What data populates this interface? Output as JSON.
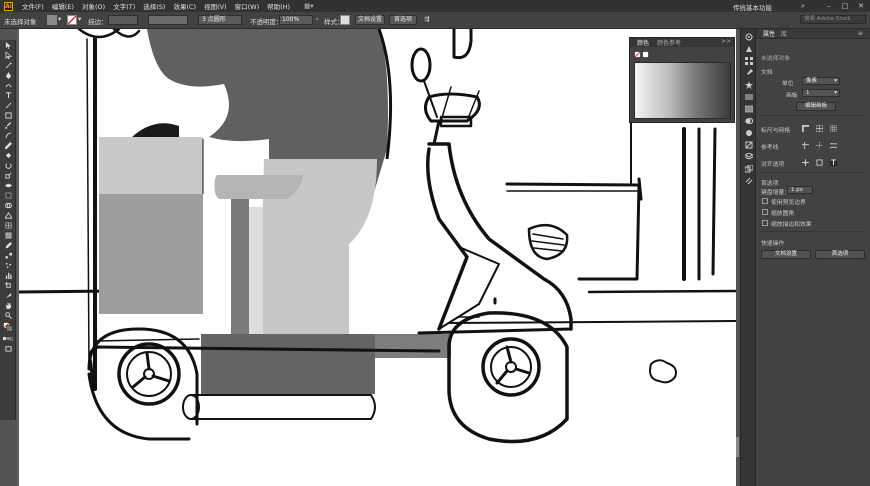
{
  "app": {
    "logo": "Ai",
    "accent": "#ff9a00"
  },
  "menu": {
    "items": [
      "文件(F)",
      "编辑(E)",
      "对象(O)",
      "文字(T)",
      "选择(S)",
      "效果(C)",
      "视图(V)",
      "窗口(W)",
      "帮助(H)"
    ],
    "layout_icon": "arrange-documents-icon",
    "workspace": "传统基本功能"
  },
  "control_bar": {
    "selection_label": "未选择对象",
    "stroke_label": "描边：",
    "brush_value": "3 点圆形",
    "opacity_label": "不透明度：",
    "opacity_value": "100%",
    "style_label": "样式：",
    "doc_setup": "文档设置",
    "preferences": "首选项",
    "search_placeholder": "搜索 Adobe Stock"
  },
  "tools": [
    "selection",
    "direct-selection",
    "magic-wand",
    "lasso",
    "pen",
    "curvature",
    "type",
    "line",
    "rectangle",
    "paintbrush",
    "shaper",
    "pencil",
    "eraser",
    "rotate",
    "scale",
    "width",
    "free-transform",
    "shape-builder",
    "perspective",
    "mesh",
    "gradient",
    "eyedropper",
    "blend",
    "symbol-sprayer",
    "column-graph",
    "artboard",
    "slice",
    "hand",
    "zoom"
  ],
  "color_panel": {
    "tab_color": "颜色",
    "tab_guide": "颜色参考",
    "collapse": ">>"
  },
  "properties": {
    "tab_properties": "属性",
    "tab_layers": "库",
    "no_selection": "未选择对象",
    "document_section": "文档",
    "units_label": "单位",
    "units_value": "像素",
    "artboard_label": "画板",
    "artboard_value": "1",
    "edit_artboards": "编辑画板",
    "rulers_grids": "标尺与网格",
    "guides": "参考线",
    "snap": "对齐选项",
    "preferences_section": "首选项",
    "keyboard_increment_label": "键盘增量：",
    "keyboard_increment_value": "1 px",
    "use_preview_bounds": "使用预览边界",
    "scale_corners": "缩放圆角",
    "scale_strokes_effects": "缩放描边和效果",
    "quick_actions": "快速操作",
    "doc_setup_button": "文档设置",
    "preferences_button": "首选项"
  }
}
